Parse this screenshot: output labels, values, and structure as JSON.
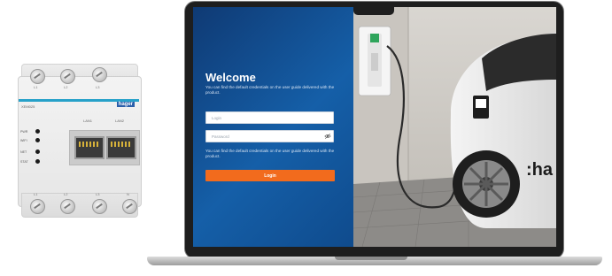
{
  "device": {
    "brand": "hager",
    "model": "XEM025",
    "top_terminals": [
      "L1",
      "L2",
      "L3"
    ],
    "bottom_terminals": [
      "L1",
      "L2",
      "L3",
      "N"
    ],
    "leds": [
      "PWR",
      "WIFI",
      "NET",
      "STAT"
    ],
    "ports": [
      "LAN1",
      "LAN2"
    ]
  },
  "login": {
    "title": "Welcome",
    "hint_top": "You can find the default credentials on the user guide delivered with the product.",
    "login_placeholder": "Login",
    "password_placeholder": "Password",
    "hint_bottom": "You can find the default credentials on the user guide delivered with the product.",
    "button_label": "Login"
  },
  "photo": {
    "car_brand_text": ":ha"
  },
  "colors": {
    "panel_blue": "#155fa8",
    "button_orange": "#f26b1d",
    "device_accent": "#27a1c9"
  }
}
